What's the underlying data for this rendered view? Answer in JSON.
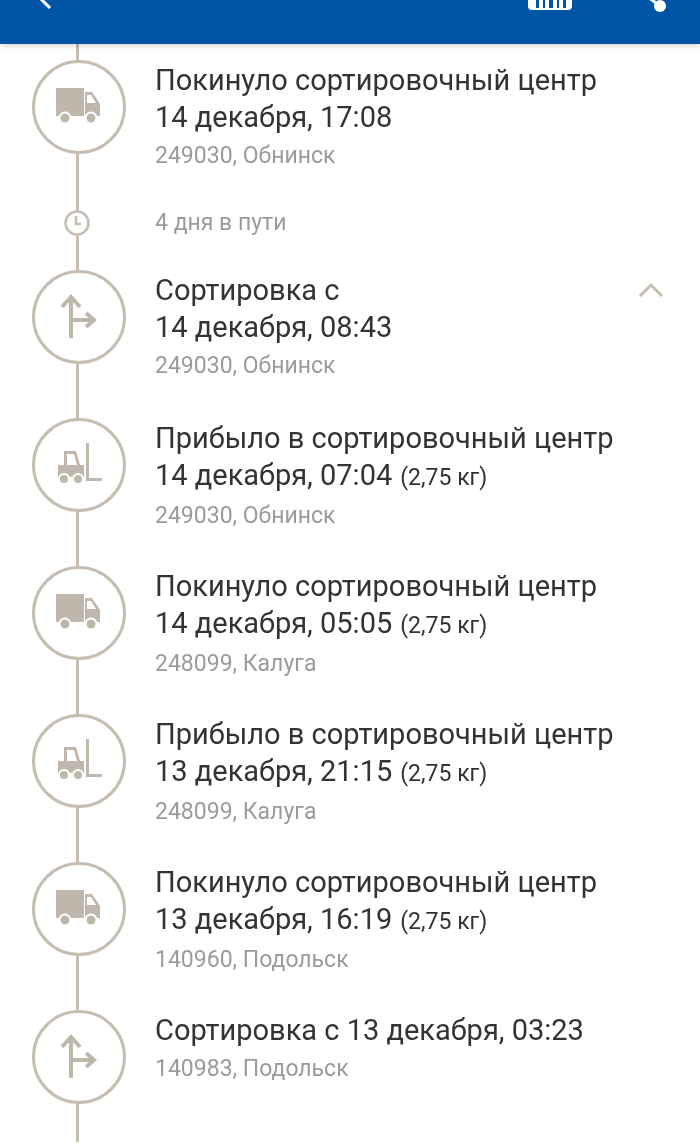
{
  "events": [
    {
      "kind": "truck",
      "title": "Покинуло сортировочный центр",
      "date": "14 декабря, 17:08",
      "location": "249030, Обнинск"
    },
    {
      "kind": "transit",
      "text": "4 дня в пути"
    },
    {
      "kind": "sort",
      "title": "Сортировка с",
      "date": "14 декабря, 08:43",
      "location": "249030, Обнинск",
      "expanded": true
    },
    {
      "kind": "forklift",
      "title": "Прибыло в сортировочный центр",
      "date": "14 декабря, 07:04",
      "weight": "(2,75 кг)",
      "location": "249030, Обнинск"
    },
    {
      "kind": "truck",
      "title": "Покинуло сортировочный центр",
      "date": "14 декабря, 05:05",
      "weight": "(2,75 кг)",
      "location": "248099, Калуга"
    },
    {
      "kind": "forklift",
      "title": "Прибыло в сортировочный центр",
      "date": "13 декабря, 21:15",
      "weight": "(2,75 кг)",
      "location": "248099, Калуга"
    },
    {
      "kind": "truck",
      "title": "Покинуло сортировочный центр",
      "date": "13 декабря, 16:19",
      "weight": "(2,75 кг)",
      "location": "140960, Подольск"
    },
    {
      "kind": "sort",
      "title": "Сортировка с 13 декабря, 03:23",
      "location": "140983, Подольск"
    }
  ]
}
